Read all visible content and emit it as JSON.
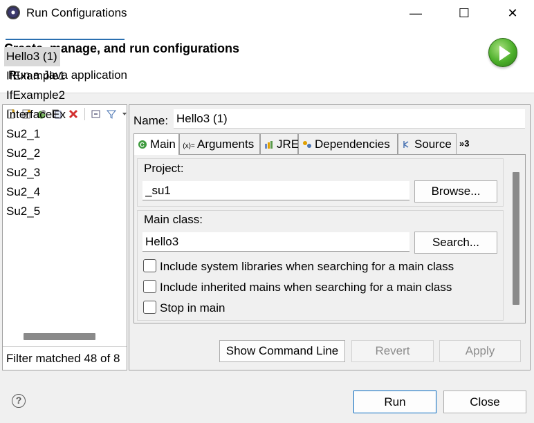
{
  "window": {
    "title": "Run Configurations",
    "minimize_glyph": "—",
    "maximize_glyph": "☐",
    "close_glyph": "✕"
  },
  "header": {
    "title": "Create, manage, and run configurations",
    "subtitle": "Run a Java application"
  },
  "sidebar": {
    "toolbar_icons": [
      "new-launch-config-icon",
      "new-prototype-icon",
      "export-icon",
      "duplicate-icon",
      "delete-icon",
      "collapse-all-icon",
      "filter-icon"
    ],
    "filter_value": "",
    "items": [
      "Hello3 (1)",
      "IfExample1",
      "IfExample2",
      "InterfaceEx",
      "Su2_1",
      "Su2_2",
      "Su2_3",
      "Su2_4",
      "Su2_5"
    ],
    "selected_index": 0,
    "status": "Filter matched 48 of 8"
  },
  "config": {
    "name_label": "Name:",
    "name_value": "Hello3 (1)",
    "tabs": [
      {
        "label": "Main",
        "icon": "main-tab-icon",
        "glyph": "◉"
      },
      {
        "label": "Arguments",
        "icon": "arguments-tab-icon",
        "glyph": "(x)="
      },
      {
        "label": "JRE",
        "icon": "jre-tab-icon",
        "glyph": "▤"
      },
      {
        "label": "Dependencies",
        "icon": "dependencies-tab-icon",
        "glyph": "⚙"
      },
      {
        "label": "Source",
        "icon": "source-tab-icon",
        "glyph": "⌥"
      }
    ],
    "more_tabs": "»3",
    "active_tab": "Main",
    "project_label": "Project:",
    "project_value": "_su1",
    "browse_label": "Browse...",
    "main_class_label": "Main class:",
    "main_class_value": "Hello3",
    "search_label": "Search...",
    "checkboxes": [
      {
        "label": "Include system libraries when searching for a main class",
        "checked": false
      },
      {
        "label": "Include inherited mains when searching for a main class",
        "checked": false
      },
      {
        "label": "Stop in main",
        "checked": false
      }
    ],
    "show_command_line": "Show Command Line",
    "revert": "Revert",
    "apply": "Apply"
  },
  "footer": {
    "help_glyph": "?",
    "run": "Run",
    "close": "Close"
  },
  "colors": {
    "accent": "#0067c0",
    "filter_underline": "#2a6fb0",
    "run_green": "#4caf2a",
    "delete_red": "#d32f2f"
  }
}
